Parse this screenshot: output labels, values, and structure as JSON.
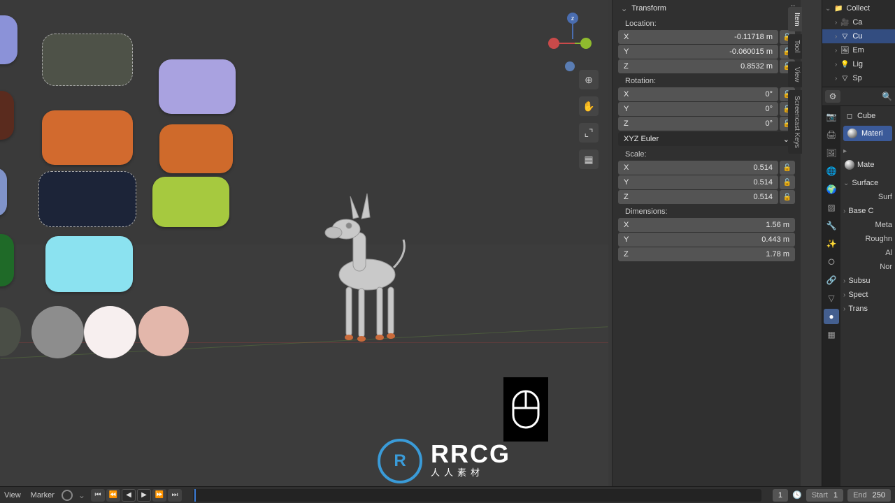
{
  "viewport": {
    "gizmo_z_label": "z",
    "tools": [
      {
        "name": "zoom-icon",
        "glyph": "⊕"
      },
      {
        "name": "move-icon",
        "glyph": "✋"
      },
      {
        "name": "camera-icon",
        "glyph": "⌞⌝"
      },
      {
        "name": "persp-icon",
        "glyph": "▦"
      }
    ],
    "palette": [
      {
        "name": "swatch-lavender",
        "color": "#8b92d8"
      },
      {
        "name": "swatch-olive",
        "color": "#4e5248"
      },
      {
        "name": "swatch-lilac",
        "color": "#a9a2e0"
      },
      {
        "name": "swatch-maroon",
        "color": "#5a2b1e"
      },
      {
        "name": "swatch-orange",
        "color": "#d26a2e"
      },
      {
        "name": "swatch-orange-2",
        "color": "#cf6a2b"
      },
      {
        "name": "swatch-slate",
        "color": "#8093c9"
      },
      {
        "name": "swatch-navy",
        "color": "#1c2438"
      },
      {
        "name": "swatch-lime",
        "color": "#a6c93f"
      },
      {
        "name": "swatch-green",
        "color": "#1f6a28"
      },
      {
        "name": "swatch-cyan",
        "color": "#8be2f0"
      },
      {
        "name": "swatch-darkgray",
        "color": "#4a4e46"
      },
      {
        "name": "swatch-gray",
        "color": "#8d8d8d"
      },
      {
        "name": "swatch-white",
        "color": "#f7efef"
      },
      {
        "name": "swatch-pink",
        "color": "#e3b7ab"
      }
    ]
  },
  "watermark": {
    "logo": "R",
    "text": "RRCG",
    "sub": "人人素材"
  },
  "npanel": {
    "header": "Transform",
    "tabs": {
      "item": "Item",
      "tool": "Tool",
      "view": "View",
      "screencast": "Screencast Keys"
    },
    "sections": {
      "location": {
        "label": "Location:",
        "x": {
          "axis": "X",
          "value": "-0.11718 m"
        },
        "y": {
          "axis": "Y",
          "value": "-0.060015 m"
        },
        "z": {
          "axis": "Z",
          "value": "0.8532 m"
        }
      },
      "rotation": {
        "label": "Rotation:",
        "x": {
          "axis": "X",
          "value": "0°"
        },
        "y": {
          "axis": "Y",
          "value": "0°"
        },
        "z": {
          "axis": "Z",
          "value": "0°"
        },
        "mode": "XYZ Euler"
      },
      "scale": {
        "label": "Scale:",
        "x": {
          "axis": "X",
          "value": "0.514"
        },
        "y": {
          "axis": "Y",
          "value": "0.514"
        },
        "z": {
          "axis": "Z",
          "value": "0.514"
        }
      },
      "dimensions": {
        "label": "Dimensions:",
        "x": {
          "axis": "X",
          "value": "1.56 m"
        },
        "y": {
          "axis": "Y",
          "value": "0.443 m"
        },
        "z": {
          "axis": "Z",
          "value": "1.78 m"
        }
      }
    }
  },
  "outliner": {
    "collection": "Collect",
    "items": [
      {
        "name": "Ca",
        "icon": "🎥"
      },
      {
        "name": "Cu",
        "icon": "▽",
        "selected": true
      },
      {
        "name": "Em",
        "icon": "🖼"
      },
      {
        "name": "Lig",
        "icon": "💡"
      },
      {
        "name": "Sp",
        "icon": "▽"
      }
    ]
  },
  "properties": {
    "breadcrumb": "Cube",
    "material_slot": "Materi",
    "material_dd": "Mate",
    "surface_hdr": "Surface",
    "rows": {
      "surf": "Surf",
      "basec": "Base C",
      "meta": "Meta",
      "rough": "Roughn",
      "al": "Al",
      "nor": "Nor",
      "subsu": "Subsu",
      "spect": "Spect",
      "trans": "Trans"
    },
    "tabs": [
      {
        "name": "tab-render",
        "glyph": "📷"
      },
      {
        "name": "tab-output",
        "glyph": "🖨"
      },
      {
        "name": "tab-viewlayer",
        "glyph": "🖼"
      },
      {
        "name": "tab-scene",
        "glyph": "🌐"
      },
      {
        "name": "tab-world",
        "glyph": "🌍"
      },
      {
        "name": "tab-object",
        "glyph": "▨"
      },
      {
        "name": "tab-modifiers",
        "glyph": "🔧"
      },
      {
        "name": "tab-particles",
        "glyph": "✨"
      },
      {
        "name": "tab-physics",
        "glyph": "⭘"
      },
      {
        "name": "tab-constraints",
        "glyph": "🔗"
      },
      {
        "name": "tab-data",
        "glyph": "▽"
      },
      {
        "name": "tab-material",
        "glyph": "●",
        "active": true
      },
      {
        "name": "tab-texture",
        "glyph": "▦"
      }
    ]
  },
  "timeline": {
    "menu": {
      "view": "View",
      "marker": "Marker"
    },
    "current": {
      "value": "1"
    },
    "start": {
      "label": "Start",
      "value": "1"
    },
    "end": {
      "label": "End",
      "value": "250"
    }
  }
}
